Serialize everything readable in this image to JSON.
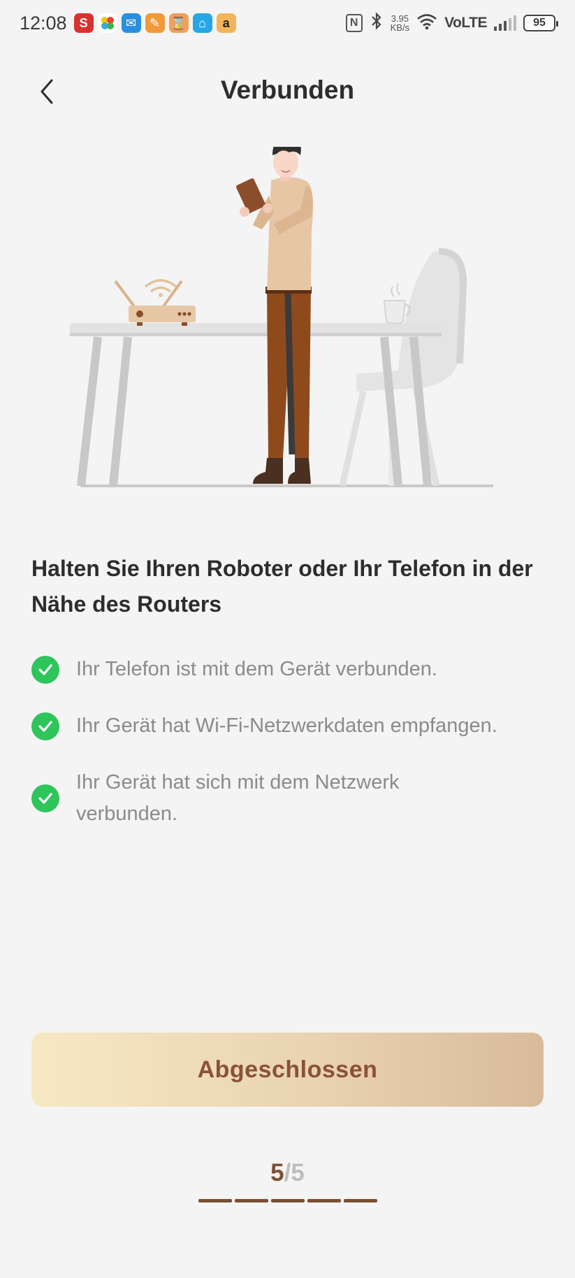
{
  "status_bar": {
    "time": "12:08",
    "app_icons": [
      {
        "name": "s-app-icon",
        "glyph": "S",
        "color": "#d8332f"
      },
      {
        "name": "pinwheel-app-icon",
        "glyph": "✿",
        "color": "#ffffff"
      },
      {
        "name": "mail-app-icon",
        "glyph": "✉",
        "color": "#2a8fe0"
      },
      {
        "name": "notes-app-icon",
        "glyph": "✎",
        "color": "#f29a3a"
      },
      {
        "name": "hourglass-app-icon",
        "glyph": "⌛",
        "color": "#f0a05a"
      },
      {
        "name": "home-app-icon",
        "glyph": "⌂",
        "color": "#27a6e6"
      },
      {
        "name": "amazon-app-icon",
        "glyph": "a",
        "color": "#f2b55a"
      }
    ],
    "nfc": "N",
    "speed_value": "3.95",
    "speed_unit": "KB/s",
    "network": "VoLTE",
    "battery": "95"
  },
  "header": {
    "title": "Verbunden"
  },
  "instruction": "Halten Sie Ihren Roboter oder Ihr Telefon in der Nähe des Routers",
  "checklist": [
    {
      "label": "Ihr Telefon ist mit dem Gerät verbunden.",
      "done": true
    },
    {
      "label": "Ihr Gerät hat Wi-Fi-Netzwerkdaten empfangen.",
      "done": true
    },
    {
      "label": "Ihr Gerät hat sich mit dem Netzwerk verbunden.",
      "done": true
    }
  ],
  "done_button": {
    "label": "Abgeschlossen"
  },
  "steps": {
    "current": "5",
    "separator": "/",
    "total": "5"
  },
  "colors": {
    "accent_brown": "#7c4f35",
    "check_green": "#2ec55a",
    "button_gradient_start": "#f7e9c3",
    "button_gradient_end": "#d8bb9a"
  }
}
